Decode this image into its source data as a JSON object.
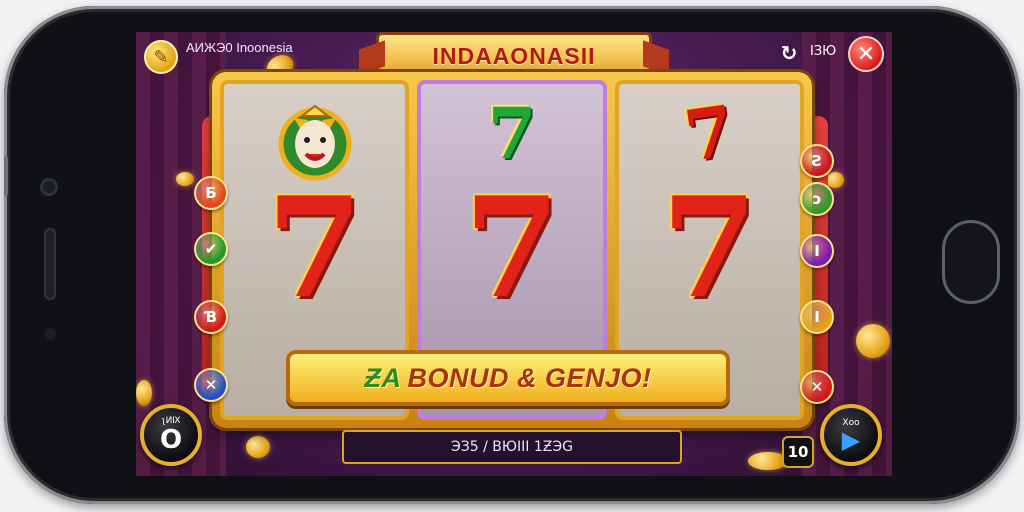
{
  "header": {
    "app_label": "AИЖЭ0 Inoonesia",
    "banner_title": "INDAAONASII",
    "top_right_label": "IЗЮ",
    "top_right_icon": "refresh-icon",
    "close_icon": "close-icon",
    "menu_icon": "wrench-icon"
  },
  "reels": [
    {
      "top_symbol": "mascot",
      "main_symbol": "7"
    },
    {
      "top_symbol": "7",
      "main_symbol": "7"
    },
    {
      "top_symbol": "7",
      "main_symbol": "7"
    }
  ],
  "side_left": [
    {
      "label": "Ƃ",
      "color": "#e2481e"
    },
    {
      "label": "✔",
      "color": "#1f9a2a"
    },
    {
      "label": "Ɓ",
      "color": "#d2191a"
    },
    {
      "label": "✕",
      "color": "#2050c8"
    }
  ],
  "side_right": [
    {
      "label": "Ƨ",
      "color": "#c8181a"
    },
    {
      "label": "ↄ",
      "color": "#2e9a2a"
    },
    {
      "label": "I",
      "color": "#7a1ab0"
    },
    {
      "label": "I",
      "color": "#e2a317"
    },
    {
      "label": "✕",
      "color": "#d2191a"
    }
  ],
  "bonus": {
    "prefix": "ƵA",
    "text": "BONUD & GENJO!"
  },
  "status_bar": {
    "text": "ЭЗ5 / ВЮIII 1ƵЭG"
  },
  "controls": {
    "left_caption": "ʅИⅨ",
    "left_glyph": "O",
    "right_caption": "Ⅹᴏᴏ",
    "counter": "10"
  },
  "colors": {
    "accent_gold": "#e9a521",
    "seven_red": "#e2231a",
    "seven_green": "#21a63a",
    "background_purple": "#4c1d55"
  }
}
